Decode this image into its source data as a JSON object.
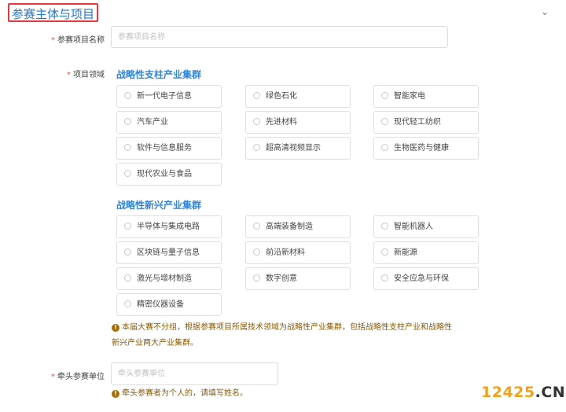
{
  "section": {
    "title": "参赛主体与项目",
    "collapse_icon": "chevron-down-icon"
  },
  "project_name": {
    "required_mark": "*",
    "label": "参赛项目名称",
    "placeholder": "参赛项目名称"
  },
  "project_field": {
    "required_mark": "*",
    "label": "项目领域",
    "groups": [
      {
        "title": "战略性支柱产业集群",
        "options": [
          "新一代电子信息",
          "绿色石化",
          "智能家电",
          "汽车产业",
          "先进材料",
          "现代轻工纺织",
          "软件与信息服务",
          "超高清视频显示",
          "生物医药与健康",
          "现代农业与食品"
        ]
      },
      {
        "title": "战略性新兴产业集群",
        "options": [
          "半导体与集成电路",
          "高端装备制造",
          "智能机器人",
          "区块链与量子信息",
          "前沿新材料",
          "新能源",
          "激光与增材制造",
          "数字创意",
          "安全应急与环保",
          "精密仪器设备"
        ]
      }
    ],
    "note_line1": "本届大赛不分组，根据参赛项目所属技术领域为战略性产业集群，包括战略性支柱产业和战略性",
    "note_line2": "新兴产业两大产业集群。"
  },
  "lead_unit": {
    "required_mark": "*",
    "label": "牵头参赛单位",
    "placeholder": "牵头参赛单位",
    "note": "牵头参赛者为个人的，请填写姓名。"
  },
  "watermark": {
    "part1": "12425",
    "part2": ".CN"
  }
}
